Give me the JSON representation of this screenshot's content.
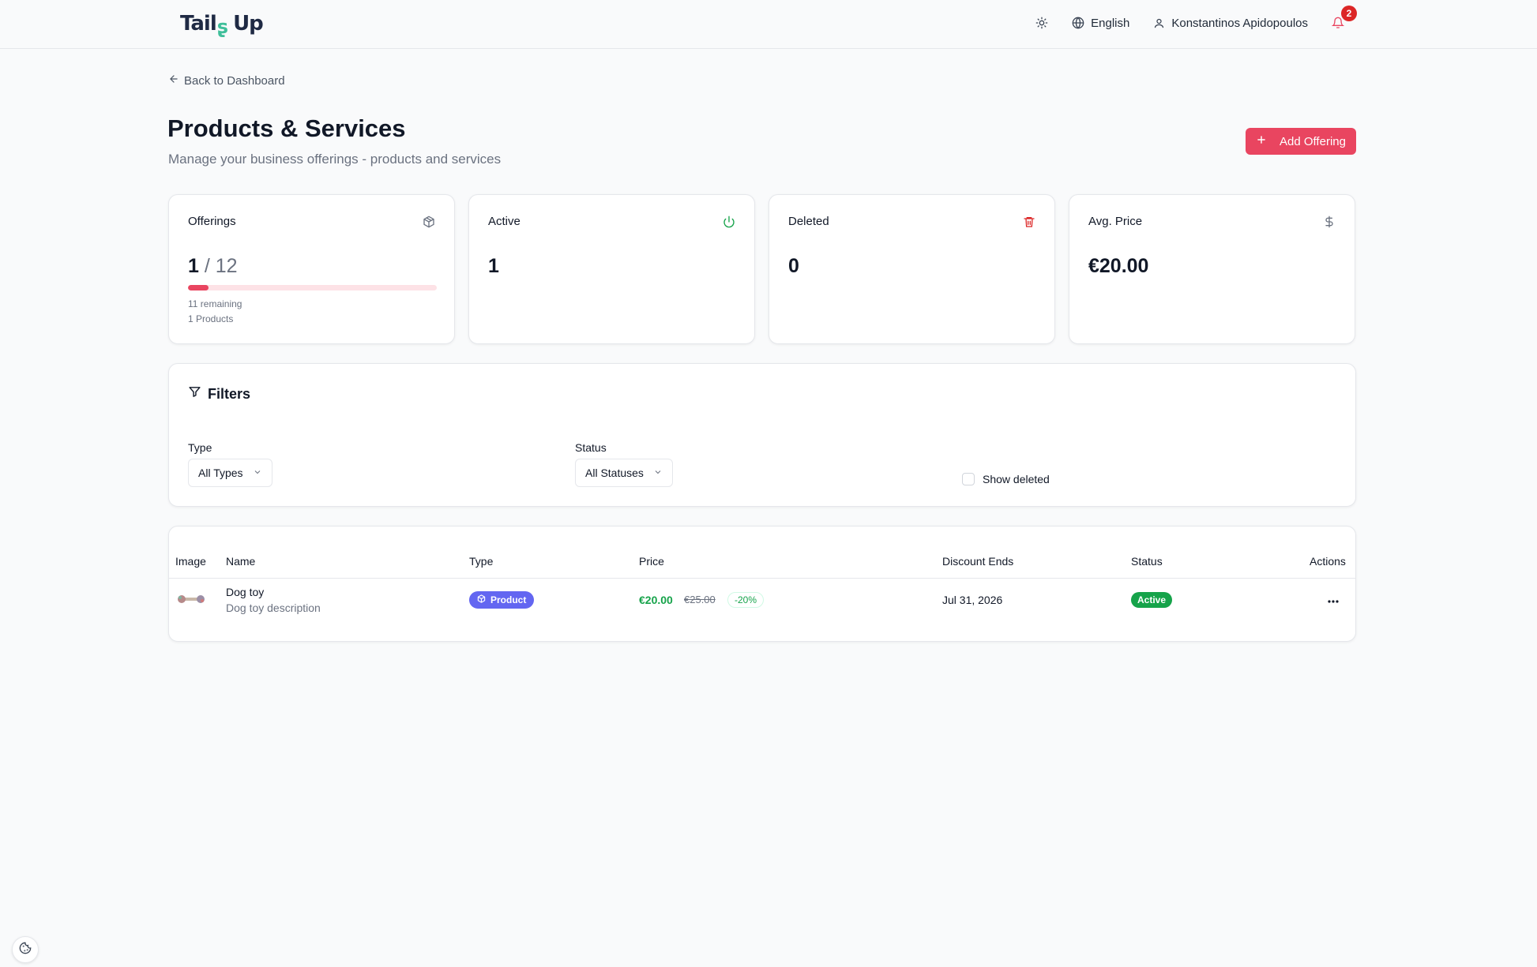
{
  "header": {
    "logo": "Tails Up",
    "language": "English",
    "user_name": "Konstantinos Apidopoulos",
    "notification_count": "2"
  },
  "nav": {
    "back_label": "Back to Dashboard"
  },
  "page": {
    "title": "Products & Services",
    "subtitle": "Manage your business offerings - products and services",
    "add_button_label": "Add Offering"
  },
  "stats": {
    "offerings": {
      "title": "Offerings",
      "current": "1",
      "separator": "/",
      "max": "12",
      "remaining": "11 remaining",
      "products": "1 Products",
      "progress_fraction": 0.0833
    },
    "active": {
      "title": "Active",
      "value": "1"
    },
    "deleted": {
      "title": "Deleted",
      "value": "0"
    },
    "avg_price": {
      "title": "Avg. Price",
      "value": "€20.00"
    }
  },
  "filters": {
    "title": "Filters",
    "type_label": "Type",
    "type_value": "All Types",
    "status_label": "Status",
    "status_value": "All Statuses",
    "show_deleted_label": "Show deleted"
  },
  "table": {
    "columns": [
      "Image",
      "Name",
      "Type",
      "Price",
      "Discount Ends",
      "Status",
      "Actions"
    ],
    "rows": [
      {
        "name": "Dog toy",
        "description": "Dog toy description",
        "type": "Product",
        "price": "€20.00",
        "original_price": "€25.00",
        "discount": "-20%",
        "discount_ends": "Jul 31, 2026",
        "status": "Active"
      }
    ]
  },
  "colors": {
    "accent": "#e94560",
    "success": "#16a34a",
    "danger": "#dc2626",
    "product_pill": "#6366f1"
  },
  "icons": {
    "theme": "sun-icon",
    "language": "globe-icon",
    "user": "user-icon",
    "notifications": "bell-icon",
    "offerings": "package-icon",
    "active": "power-icon",
    "deleted": "trash-icon",
    "avg_price": "dollar-icon",
    "filters": "filter-icon",
    "cookie": "cookie-icon"
  }
}
